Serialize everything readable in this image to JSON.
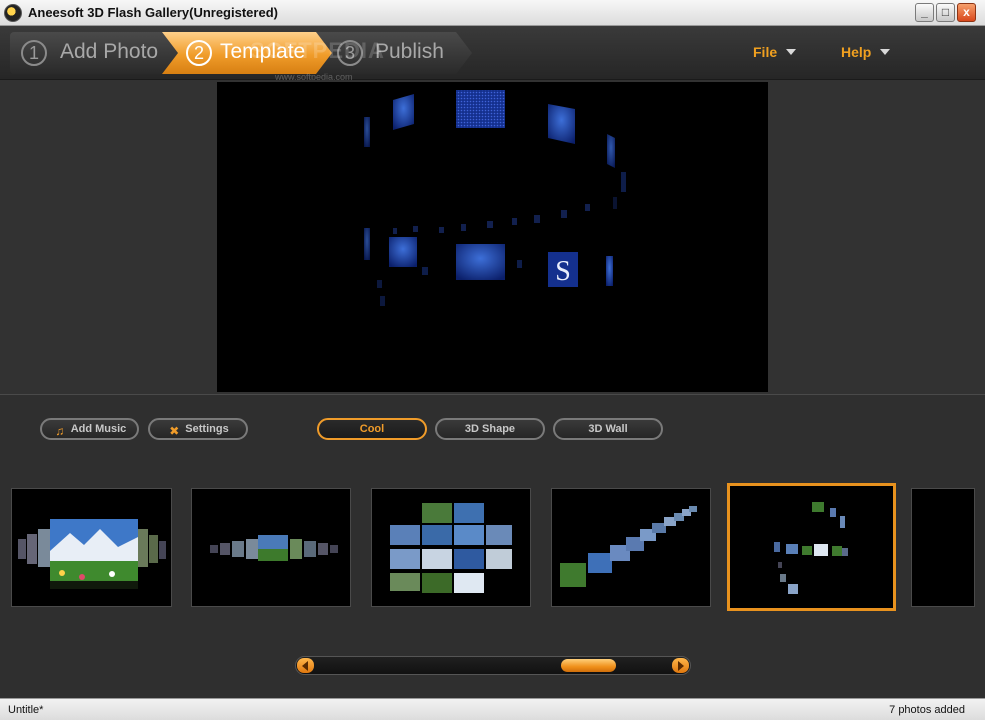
{
  "window": {
    "title": "Aneesoft 3D Flash Gallery(Unregistered)",
    "controls": [
      "_",
      "□",
      "x"
    ]
  },
  "steps": [
    {
      "num": "1",
      "label": "Add Photo"
    },
    {
      "num": "2",
      "label": "Template"
    },
    {
      "num": "3",
      "label": "Publish"
    }
  ],
  "watermark": {
    "text": "SOFTPEDIA",
    "url": "www.softpedia.com"
  },
  "menu": {
    "file": "File",
    "help": "Help"
  },
  "toolbar": {
    "add_music": "Add Music",
    "settings": "Settings"
  },
  "template_tabs": {
    "cool": "Cool",
    "shape": "3D Shape",
    "wall": "3D Wall",
    "selected": "Cool"
  },
  "preview": {
    "logo_letter": "S"
  },
  "status": {
    "document": "Untitle*",
    "photos": "7 photos added"
  },
  "colors": {
    "accent": "#f09c2a",
    "selected_border": "#e8921e",
    "background": "#2f2f2f"
  },
  "icons": {
    "add_music": "music-note-plus-icon",
    "settings": "tools-icon"
  }
}
